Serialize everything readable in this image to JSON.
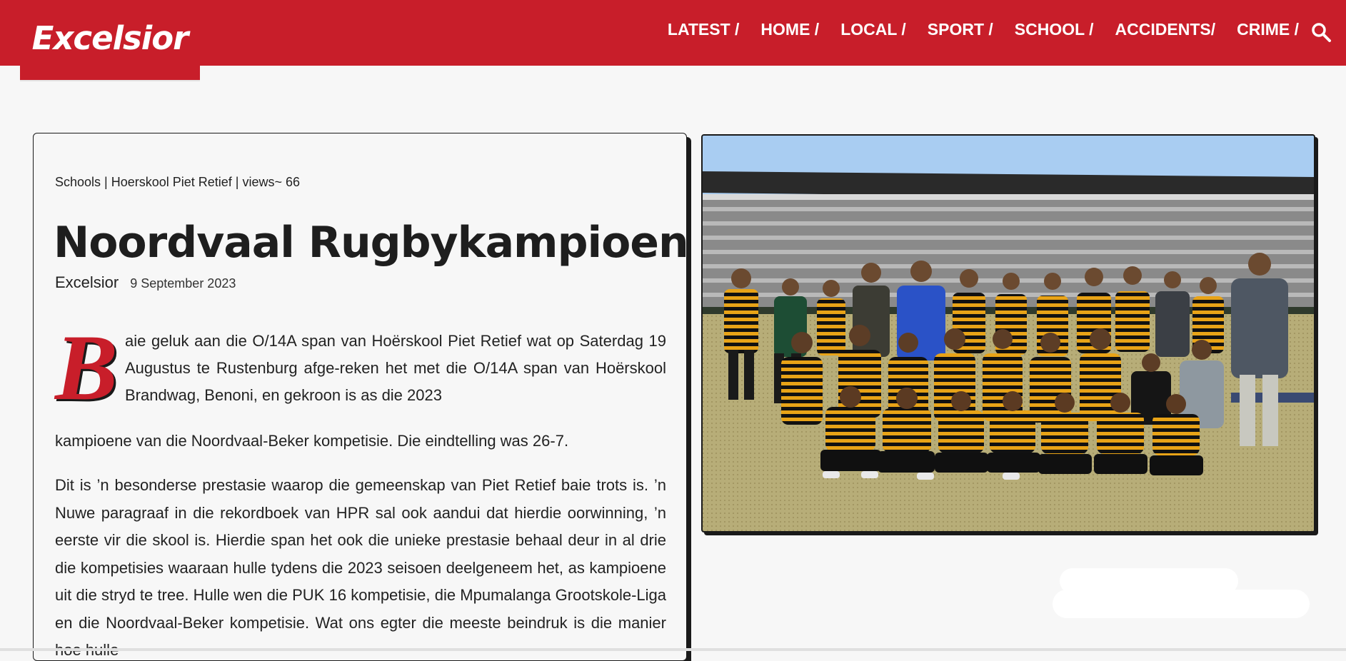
{
  "header": {
    "logo": "Excelsior",
    "nav": [
      "LATEST /",
      "HOME /",
      "LOCAL /",
      "SPORT /",
      "SCHOOL /",
      "ACCIDENTS/",
      "CRIME /"
    ],
    "search_icon": "search-icon",
    "brand_color": "#c81e2a"
  },
  "article": {
    "meta": "Schools | Hoerskool Piet Retief | views~ 66",
    "title": "Noordvaal Rugbykampioene",
    "author": "Excelsior",
    "date": "9 September 2023",
    "dropcap": "B",
    "para1_lead": "aie geluk aan die O/14A span van Hoërskool Piet Retief wat op Saterdag 19 Augustus te Rustenburg afge-reken het met die O/14A span van Hoërskool Brandwag, Benoni, en gekroon is as die 2023",
    "para1_cont": "kampioene van die Noordvaal-Beker kompetisie. Die eindtelling was 26-7.",
    "para2": "Dit is ’n besonderse prestasie waarop die gemeenskap van Piet Retief baie trots is. ’n Nuwe paragraaf in die rekordboek van HPR sal ook aandui dat hierdie oorwinning, ’n eerste vir die skool is. Hierdie span het ook die unieke prestasie behaal deur in al drie die kompetisies waaraan hulle tydens die 2023 seisoen deelgeneem het, as kampioene uit die stryd te tree. Hulle wen die PUK 16 kompetisie, die Mpumalanga Grootskole-Liga en die Noordvaal-Beker kompetisie. Wat ons egter die meeste beindruk is die manier hoe hulle"
  }
}
